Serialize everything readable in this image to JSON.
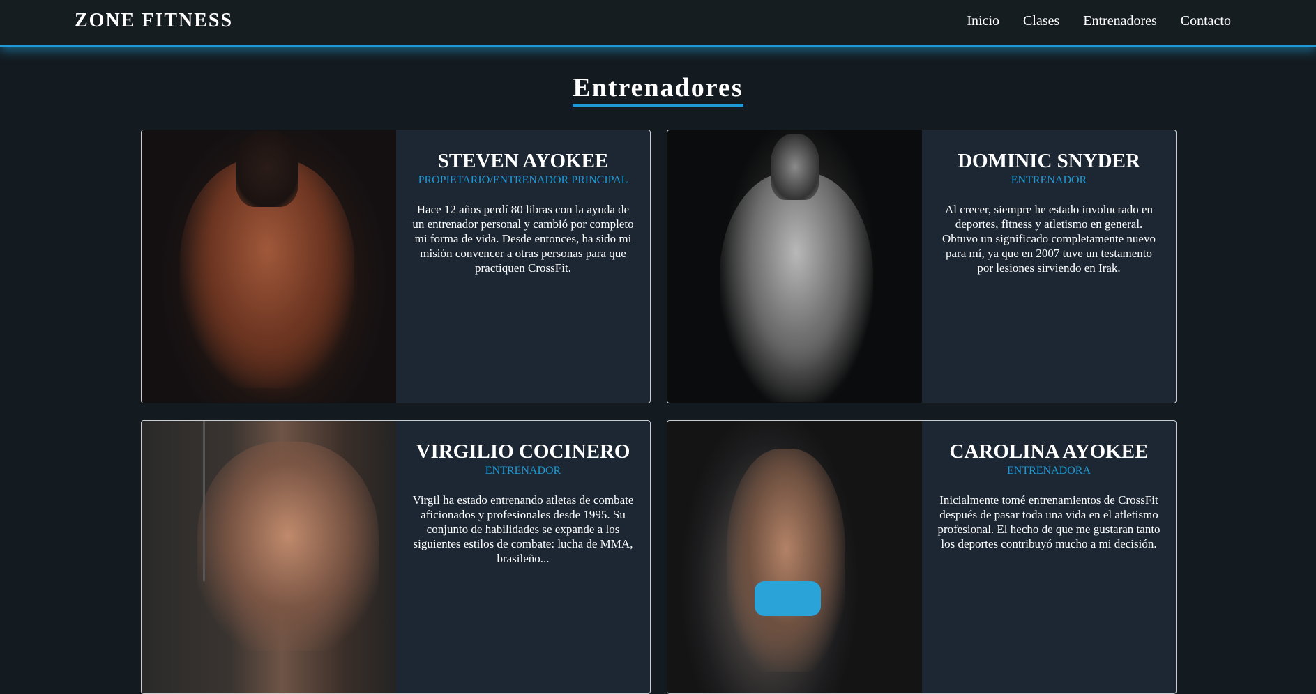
{
  "header": {
    "brand": "ZONE FITNESS",
    "nav": [
      "Inicio",
      "Clases",
      "Entrenadores",
      "Contacto"
    ]
  },
  "section": {
    "title": "Entrenadores"
  },
  "trainers": [
    {
      "name": "STEVEN AYOKEE",
      "role": "PROPIETARIO/ENTRENADOR PRINCIPAL",
      "bio": "Hace 12 años perdí 80 libras con la ayuda de un entrenador personal y cambió por completo mi forma de vida. Desde entonces, ha sido mi misión convencer a otras personas para que practiquen CrossFit.",
      "photo": "muscular-man-flexing-photo"
    },
    {
      "name": "DOMINIC SNYDER",
      "role": "ENTRENADOR",
      "bio": "Al crecer, siempre he estado involucrado en deportes, fitness y atletismo en general. Obtuvo un significado completamente nuevo para mí, ya que en 2007 tuve un testamento por lesiones sirviendo en Irak.",
      "photo": "shirtless-man-bw-photo"
    },
    {
      "name": "VIRGILIO COCINERO",
      "role": "ENTRENADOR",
      "bio": "Virgil ha estado entrenando atletas de combate aficionados y profesionales desde 1995. Su conjunto de habilidades se expande a los siguientes estilos de combate: lucha de MMA, brasileño...",
      "photo": "man-cable-training-photo"
    },
    {
      "name": "CAROLINA AYOKEE",
      "role": "ENTRENADORA",
      "bio": "Inicialmente tomé entrenamientos de CrossFit después de pasar toda una vida en el atletismo profesional. El hecho de que me gustaran tanto los deportes contribuyó mucho a mi decisión.",
      "photo": "woman-gym-training-photo"
    }
  ],
  "colors": {
    "background": "#141b20",
    "card": "#1c2733",
    "accent": "#1d9ad6"
  }
}
